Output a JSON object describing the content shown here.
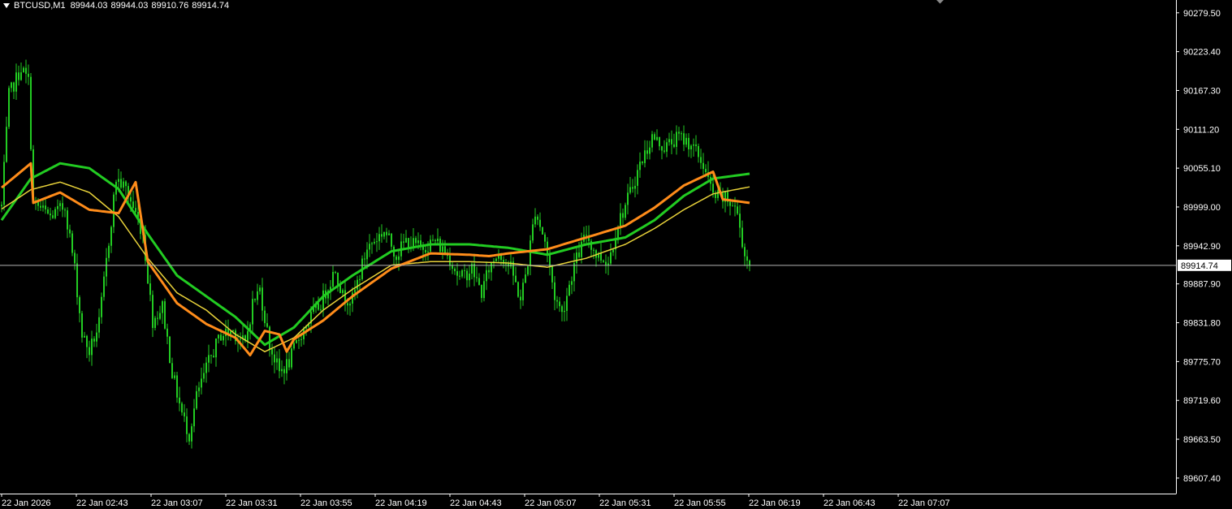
{
  "header": {
    "symbol": "BTCUSD,M1",
    "ohlc": [
      "89944.03",
      "89944.03",
      "89910.76",
      "89914.74"
    ]
  },
  "chart_data": {
    "type": "candlestick",
    "symbol": "BTCUSD",
    "timeframe": "M1",
    "open": 89944.03,
    "high": 89944.03,
    "low": 89910.76,
    "close": 89914.74,
    "current_price": 89914.74,
    "current_price_label": "89914.74",
    "ylim": [
      89585.0,
      90298.0
    ],
    "y_ticks": [
      "90279.50",
      "90223.40",
      "90167.30",
      "90111.20",
      "90055.10",
      "89999.00",
      "89942.90",
      "89887.90",
      "89831.80",
      "89775.70",
      "89719.60",
      "89663.50",
      "89607.40"
    ],
    "x_ticks": [
      "22 Jan 2026",
      "22 Jan 02:43",
      "22 Jan 03:07",
      "22 Jan 03:31",
      "22 Jan 03:55",
      "22 Jan 04:19",
      "22 Jan 04:43",
      "22 Jan 05:07",
      "22 Jan 05:31",
      "22 Jan 05:55",
      "22 Jan 06:19",
      "22 Jan 06:43",
      "22 Jan 07:07"
    ],
    "price_series_keyframes": [
      {
        "bar": 0,
        "price": 90000
      },
      {
        "bar": 3,
        "price": 90160
      },
      {
        "bar": 8,
        "price": 90200
      },
      {
        "bar": 11,
        "price": 90180
      },
      {
        "bar": 13,
        "price": 90005
      },
      {
        "bar": 20,
        "price": 89985
      },
      {
        "bar": 26,
        "price": 90000
      },
      {
        "bar": 30,
        "price": 89910
      },
      {
        "bar": 33,
        "price": 89815
      },
      {
        "bar": 36,
        "price": 89790
      },
      {
        "bar": 40,
        "price": 89830
      },
      {
        "bar": 44,
        "price": 89950
      },
      {
        "bar": 47,
        "price": 90040
      },
      {
        "bar": 51,
        "price": 90025
      },
      {
        "bar": 55,
        "price": 89990
      },
      {
        "bar": 58,
        "price": 89960
      },
      {
        "bar": 62,
        "price": 89835
      },
      {
        "bar": 66,
        "price": 89855
      },
      {
        "bar": 70,
        "price": 89760
      },
      {
        "bar": 74,
        "price": 89700
      },
      {
        "bar": 77,
        "price": 89670
      },
      {
        "bar": 80,
        "price": 89725
      },
      {
        "bar": 85,
        "price": 89775
      },
      {
        "bar": 90,
        "price": 89815
      },
      {
        "bar": 95,
        "price": 89820
      },
      {
        "bar": 100,
        "price": 89800
      },
      {
        "bar": 103,
        "price": 89860
      },
      {
        "bar": 106,
        "price": 89880
      },
      {
        "bar": 110,
        "price": 89800
      },
      {
        "bar": 114,
        "price": 89760
      },
      {
        "bar": 118,
        "price": 89775
      },
      {
        "bar": 122,
        "price": 89810
      },
      {
        "bar": 126,
        "price": 89835
      },
      {
        "bar": 131,
        "price": 89860
      },
      {
        "bar": 137,
        "price": 89910
      },
      {
        "bar": 140,
        "price": 89870
      },
      {
        "bar": 144,
        "price": 89865
      },
      {
        "bar": 150,
        "price": 89940
      },
      {
        "bar": 157,
        "price": 89965
      },
      {
        "bar": 162,
        "price": 89930
      },
      {
        "bar": 166,
        "price": 89950
      },
      {
        "bar": 172,
        "price": 89940
      },
      {
        "bar": 178,
        "price": 89950
      },
      {
        "bar": 184,
        "price": 89925
      },
      {
        "bar": 188,
        "price": 89895
      },
      {
        "bar": 193,
        "price": 89910
      },
      {
        "bar": 197,
        "price": 89875
      },
      {
        "bar": 200,
        "price": 89910
      },
      {
        "bar": 204,
        "price": 89935
      },
      {
        "bar": 209,
        "price": 89910
      },
      {
        "bar": 213,
        "price": 89865
      },
      {
        "bar": 216,
        "price": 89920
      },
      {
        "bar": 219,
        "price": 89995
      },
      {
        "bar": 223,
        "price": 89950
      },
      {
        "bar": 227,
        "price": 89870
      },
      {
        "bar": 230,
        "price": 89845
      },
      {
        "bar": 235,
        "price": 89915
      },
      {
        "bar": 240,
        "price": 89960
      },
      {
        "bar": 244,
        "price": 89930
      },
      {
        "bar": 249,
        "price": 89920
      },
      {
        "bar": 253,
        "price": 89975
      },
      {
        "bar": 257,
        "price": 90010
      },
      {
        "bar": 262,
        "price": 90060
      },
      {
        "bar": 267,
        "price": 90100
      },
      {
        "bar": 272,
        "price": 90085
      },
      {
        "bar": 278,
        "price": 90100
      },
      {
        "bar": 283,
        "price": 90090
      },
      {
        "bar": 288,
        "price": 90060
      },
      {
        "bar": 292,
        "price": 90015
      },
      {
        "bar": 297,
        "price": 90010
      },
      {
        "bar": 301,
        "price": 90000
      },
      {
        "bar": 303,
        "price": 89970
      },
      {
        "bar": 305,
        "price": 89930
      },
      {
        "bar": 307,
        "price": 89915
      }
    ],
    "bands": [
      {
        "role": "upper",
        "color": "#22cc22",
        "keyframes": [
          {
            "bar": 0,
            "price": 89980
          },
          {
            "bar": 12,
            "price": 90040
          },
          {
            "bar": 24,
            "price": 90062
          },
          {
            "bar": 36,
            "price": 90055
          },
          {
            "bar": 48,
            "price": 90025
          },
          {
            "bar": 60,
            "price": 89960
          },
          {
            "bar": 72,
            "price": 89900
          },
          {
            "bar": 84,
            "price": 89870
          },
          {
            "bar": 96,
            "price": 89840
          },
          {
            "bar": 108,
            "price": 89800
          },
          {
            "bar": 120,
            "price": 89825
          },
          {
            "bar": 132,
            "price": 89870
          },
          {
            "bar": 144,
            "price": 89900
          },
          {
            "bar": 160,
            "price": 89935
          },
          {
            "bar": 176,
            "price": 89945
          },
          {
            "bar": 192,
            "price": 89945
          },
          {
            "bar": 208,
            "price": 89940
          },
          {
            "bar": 224,
            "price": 89930
          },
          {
            "bar": 240,
            "price": 89945
          },
          {
            "bar": 256,
            "price": 89955
          },
          {
            "bar": 268,
            "price": 89980
          },
          {
            "bar": 280,
            "price": 90015
          },
          {
            "bar": 292,
            "price": 90040
          },
          {
            "bar": 307,
            "price": 90047
          }
        ]
      },
      {
        "role": "middle",
        "color": "#e8d23a",
        "keyframes": [
          {
            "bar": 0,
            "price": 89996
          },
          {
            "bar": 12,
            "price": 90024
          },
          {
            "bar": 24,
            "price": 90035
          },
          {
            "bar": 36,
            "price": 90020
          },
          {
            "bar": 48,
            "price": 89985
          },
          {
            "bar": 60,
            "price": 89925
          },
          {
            "bar": 72,
            "price": 89875
          },
          {
            "bar": 84,
            "price": 89850
          },
          {
            "bar": 96,
            "price": 89815
          },
          {
            "bar": 108,
            "price": 89790
          },
          {
            "bar": 120,
            "price": 89810
          },
          {
            "bar": 132,
            "price": 89850
          },
          {
            "bar": 144,
            "price": 89880
          },
          {
            "bar": 160,
            "price": 89915
          },
          {
            "bar": 176,
            "price": 89920
          },
          {
            "bar": 192,
            "price": 89920
          },
          {
            "bar": 208,
            "price": 89918
          },
          {
            "bar": 224,
            "price": 89912
          },
          {
            "bar": 240,
            "price": 89925
          },
          {
            "bar": 256,
            "price": 89945
          },
          {
            "bar": 268,
            "price": 89968
          },
          {
            "bar": 280,
            "price": 89995
          },
          {
            "bar": 292,
            "price": 90018
          },
          {
            "bar": 307,
            "price": 90028
          }
        ]
      },
      {
        "role": "lower",
        "color": "#ff8c1a",
        "keyframes": [
          {
            "bar": 0,
            "price": 90027
          },
          {
            "bar": 12,
            "price": 90062
          },
          {
            "bar": 13,
            "price": 90005
          },
          {
            "bar": 24,
            "price": 90020
          },
          {
            "bar": 36,
            "price": 89995
          },
          {
            "bar": 48,
            "price": 89990
          },
          {
            "bar": 55,
            "price": 90035
          },
          {
            "bar": 60,
            "price": 89920
          },
          {
            "bar": 72,
            "price": 89860
          },
          {
            "bar": 84,
            "price": 89830
          },
          {
            "bar": 96,
            "price": 89810
          },
          {
            "bar": 102,
            "price": 89785
          },
          {
            "bar": 108,
            "price": 89820
          },
          {
            "bar": 114,
            "price": 89815
          },
          {
            "bar": 117,
            "price": 89790
          },
          {
            "bar": 120,
            "price": 89808
          },
          {
            "bar": 132,
            "price": 89835
          },
          {
            "bar": 144,
            "price": 89870
          },
          {
            "bar": 160,
            "price": 89910
          },
          {
            "bar": 176,
            "price": 89932
          },
          {
            "bar": 192,
            "price": 89930
          },
          {
            "bar": 200,
            "price": 89928
          },
          {
            "bar": 208,
            "price": 89932
          },
          {
            "bar": 224,
            "price": 89938
          },
          {
            "bar": 240,
            "price": 89955
          },
          {
            "bar": 256,
            "price": 89972
          },
          {
            "bar": 268,
            "price": 89998
          },
          {
            "bar": 280,
            "price": 90030
          },
          {
            "bar": 292,
            "price": 90050
          },
          {
            "bar": 296,
            "price": 90010
          },
          {
            "bar": 307,
            "price": 90005
          }
        ]
      }
    ],
    "colors": {
      "background": "#000000",
      "candle": "#22cc22",
      "axis": "#ffffff",
      "price_line": "#b4b4b4",
      "text": "#ffffff"
    }
  }
}
